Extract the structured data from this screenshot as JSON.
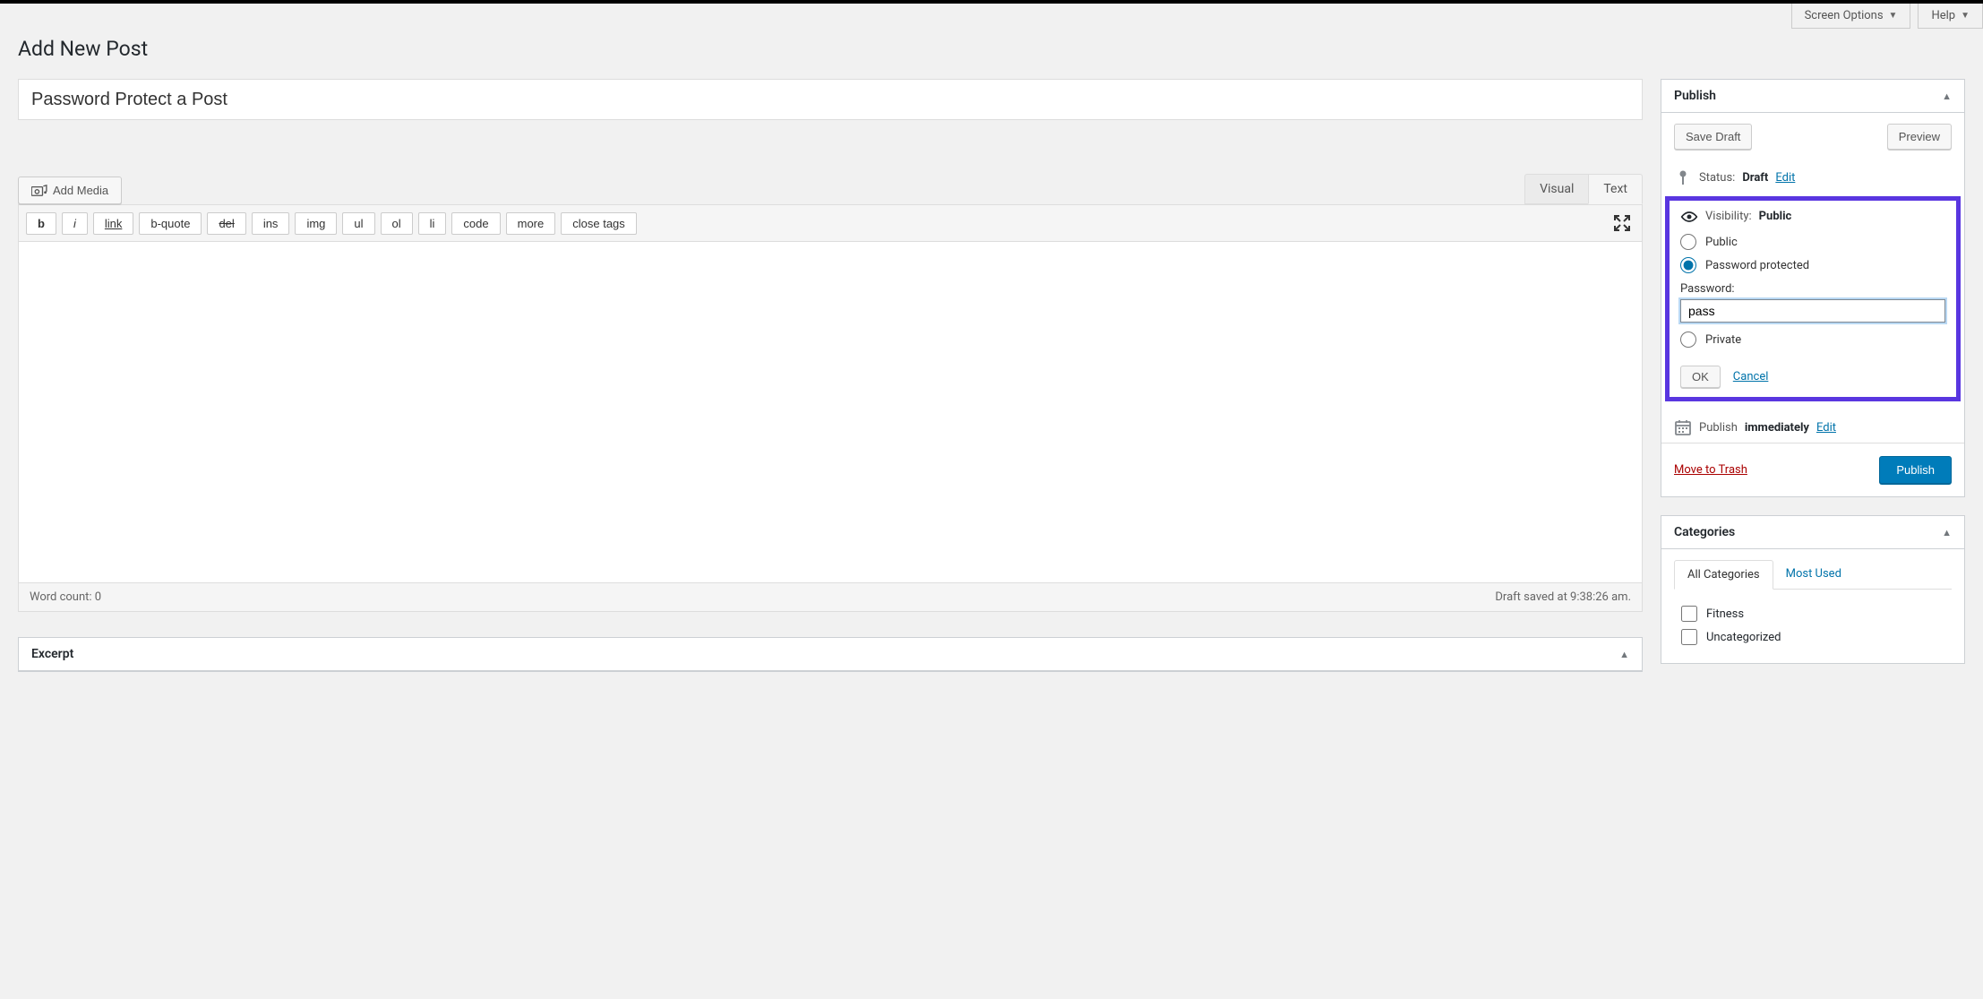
{
  "header": {
    "screen_options": "Screen Options",
    "help": "Help",
    "page_title": "Add New Post"
  },
  "post": {
    "title": "Password Protect a Post"
  },
  "media": {
    "add_media": "Add Media"
  },
  "editor_tabs": {
    "visual": "Visual",
    "text": "Text"
  },
  "quicktags": {
    "b": "b",
    "i": "i",
    "link": "link",
    "bquote": "b-quote",
    "del": "del",
    "ins": "ins",
    "img": "img",
    "ul": "ul",
    "ol": "ol",
    "li": "li",
    "code": "code",
    "more": "more",
    "close": "close tags"
  },
  "status_bar": {
    "word_count_label": "Word count: ",
    "word_count": "0",
    "draft_saved": "Draft saved at 9:38:26 am."
  },
  "publish": {
    "title": "Publish",
    "save_draft": "Save Draft",
    "preview": "Preview",
    "status_label": "Status: ",
    "status_value": "Draft",
    "edit": "Edit",
    "visibility_label": "Visibility: ",
    "visibility_value": "Public",
    "radio_public": "Public",
    "radio_password": "Password protected",
    "password_label": "Password:",
    "password_value": "pass",
    "radio_private": "Private",
    "ok": "OK",
    "cancel": "Cancel",
    "publish_label": "Publish ",
    "publish_immediately": "immediately",
    "move_to_trash": "Move to Trash",
    "publish_btn": "Publish"
  },
  "categories": {
    "title": "Categories",
    "tab_all": "All Categories",
    "tab_most_used": "Most Used",
    "items": {
      "0": "Fitness",
      "1": "Uncategorized"
    }
  },
  "excerpt": {
    "title": "Excerpt"
  }
}
